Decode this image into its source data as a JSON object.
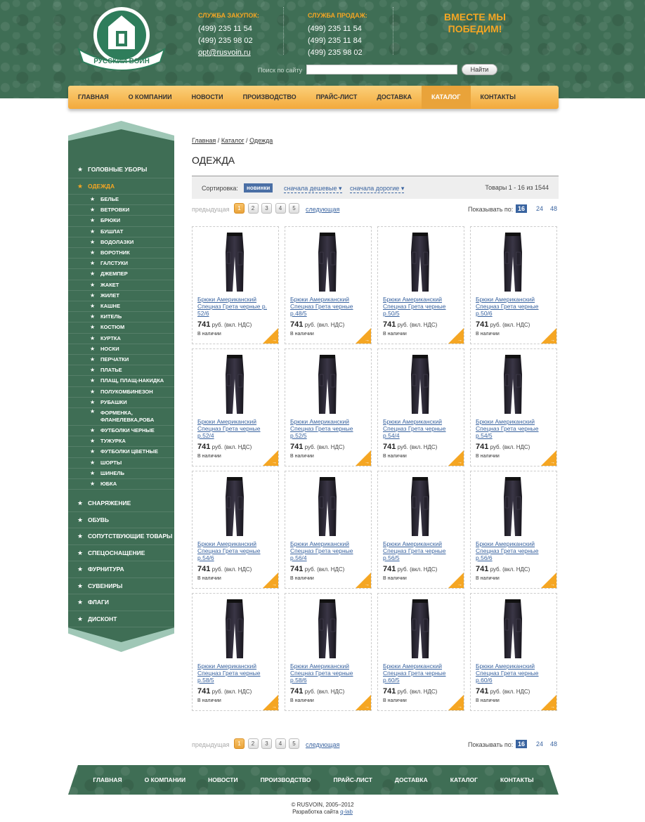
{
  "header": {
    "logo_text": "РУССКИЙ ВОИН",
    "purchase": {
      "title": "СЛУЖБА ЗАКУПОК:",
      "phone1": "(499) 235 11 54",
      "phone2": "(499) 235 98 02",
      "email": "opt@rusvoin.ru"
    },
    "sales": {
      "title": "СЛУЖБА ПРОДАЖ:",
      "phone1": "(499) 235 11 54",
      "phone2": "(499) 235 11 84",
      "phone3": "(499) 235 98 02"
    },
    "slogan_line1": "ВМЕСТЕ МЫ",
    "slogan_line2": "ПОБЕДИМ!",
    "search_label": "Поиск по сайту",
    "search_value": "",
    "search_button": "Найти"
  },
  "topnav": [
    "ГЛАВНАЯ",
    "О КОМПАНИИ",
    "НОВОСТИ",
    "ПРОИЗВОДСТВО",
    "ПРАЙС-ЛИСТ",
    "ДОСТАВКА",
    "КАТАЛОГ",
    "КОНТАКТЫ"
  ],
  "topnav_active": "КАТАЛОГ",
  "sidebar": {
    "top": [
      "ГОЛОВНЫЕ УБОРЫ",
      "ОДЕЖДА"
    ],
    "sub": [
      "БЕЛЬЕ",
      "ВЕТРОВКИ",
      "БРЮКИ",
      "БУШЛАТ",
      "ВОДОЛАЗКИ",
      "ВОРОТНИК",
      "ГАЛСТУКИ",
      "ДЖЕМПЕР",
      "ЖАКЕТ",
      "ЖИЛЕТ",
      "КАШНЕ",
      "КИТЕЛЬ",
      "КОСТЮМ",
      "КУРТКА",
      "НОСКИ",
      "ПЕРЧАТКИ",
      "ПЛАТЬЕ",
      "ПЛАЩ, ПЛАЩ-НАКИДКА",
      "ПОЛУКОМБИНЕЗОН",
      "РУБАШКИ",
      "ФОРМЕНКА, ФЛАНЕЛЕВКА,РОБА",
      "ФУТБОЛКИ ЧЕРНЫЕ",
      "ТУЖУРКА",
      "ФУТБОЛКИ ЦВЕТНЫЕ",
      "ШОРТЫ",
      "ШИНЕЛЬ",
      "ЮБКА"
    ],
    "bottom": [
      "СНАРЯЖЕНИЕ",
      "ОБУВЬ",
      "СОПУТСТВУЮЩИЕ ТОВАРЫ",
      "СПЕЦОСНАЩЕНИЕ",
      "ФУРНИТУРА",
      "СУВЕНИРЫ",
      "ФЛАГИ",
      "ДИСКОНТ"
    ],
    "active": "ОДЕЖДА"
  },
  "breadcrumb": {
    "home": "Главная",
    "catalog": "Каталог",
    "current": "Одежда",
    "sep": "/"
  },
  "page_title": "ОДЕЖДА",
  "sort": {
    "label": "Сортировка:",
    "new": "новинки",
    "cheap": "сначала дешевые",
    "expensive": "сначала дорогие",
    "count": "Товары 1 - 16 из 1544"
  },
  "pager": {
    "prev": "предыдущая",
    "pages": [
      "1",
      "2",
      "3",
      "4",
      "5"
    ],
    "current": "1",
    "next": "следующая",
    "show_label": "Показывать по:",
    "sizes": [
      "16",
      "24",
      "48"
    ],
    "current_size": "16"
  },
  "products": [
    {
      "name": "Брюки Американский Спецназ Грета черные р. 52/6",
      "price": "741",
      "unit": "руб. (вкл. НДС)",
      "stock": "В наличии"
    },
    {
      "name": "Брюки Американский Спецназ Грета черные р.48/5",
      "price": "741",
      "unit": "руб. (вкл. НДС)",
      "stock": "В наличии"
    },
    {
      "name": "Брюки Американский Спецназ Грета черные р.50/5",
      "price": "741",
      "unit": "руб. (вкл. НДС)",
      "stock": "В наличии"
    },
    {
      "name": "Брюки Американский Спецназ Грета черные р.50/6",
      "price": "741",
      "unit": "руб. (вкл. НДС)",
      "stock": "В наличии"
    },
    {
      "name": "Брюки Американский Спецназ Грета черные р.52/4",
      "price": "741",
      "unit": "руб. (вкл. НДС)",
      "stock": "В наличии"
    },
    {
      "name": "Брюки Американский Спецназ Грета черные р.52/5",
      "price": "741",
      "unit": "руб. (вкл. НДС)",
      "stock": "В наличии"
    },
    {
      "name": "Брюки Американский Спецназ Грета черные р.54/4",
      "price": "741",
      "unit": "руб. (вкл. НДС)",
      "stock": "В наличии"
    },
    {
      "name": "Брюки Американский Спецназ Грета черные р.54/5",
      "price": "741",
      "unit": "руб. (вкл. НДС)",
      "stock": "В наличии"
    },
    {
      "name": "Брюки Американский Спецназ Грета черные р.54/6",
      "price": "741",
      "unit": "руб. (вкл. НДС)",
      "stock": "В наличии"
    },
    {
      "name": "Брюки Американский Спецназ Грета черные р.56/4",
      "price": "741",
      "unit": "руб. (вкл. НДС)",
      "stock": "В наличии"
    },
    {
      "name": "Брюки Американский Спецназ Грета черные р.56/5",
      "price": "741",
      "unit": "руб. (вкл. НДС)",
      "stock": "В наличии"
    },
    {
      "name": "Брюки Американский Спецназ Грета черные р.56/6",
      "price": "741",
      "unit": "руб. (вкл. НДС)",
      "stock": "В наличии"
    },
    {
      "name": "Брюки Американский Спецназ Грета черные р.58/5",
      "price": "741",
      "unit": "руб. (вкл. НДС)",
      "stock": "В наличии"
    },
    {
      "name": "Брюки Американский Спецназ Грета черные р.58/6",
      "price": "741",
      "unit": "руб. (вкл. НДС)",
      "stock": "В наличии"
    },
    {
      "name": "Брюки Американский Спецназ Грета черные р.60/5",
      "price": "741",
      "unit": "руб. (вкл. НДС)",
      "stock": "В наличии"
    },
    {
      "name": "Брюки Американский Спецназ Грета черные р.60/6",
      "price": "741",
      "unit": "руб. (вкл. НДС)",
      "stock": "В наличии"
    }
  ],
  "footer": {
    "nav": [
      "ГЛАВНАЯ",
      "О КОМПАНИИ",
      "НОВОСТИ",
      "ПРОИЗВОДСТВО",
      "ПРАЙС-ЛИСТ",
      "ДОСТАВКА",
      "КАТАЛОГ",
      "КОНТАКТЫ"
    ],
    "copyright": "© RUSVOIN, 2005–2012",
    "dev_label": "Разработка сайта",
    "dev_link": "q-lab"
  },
  "colors": {
    "accent": "#f5a623",
    "green": "#3f6e55",
    "link": "#3a64a0"
  }
}
